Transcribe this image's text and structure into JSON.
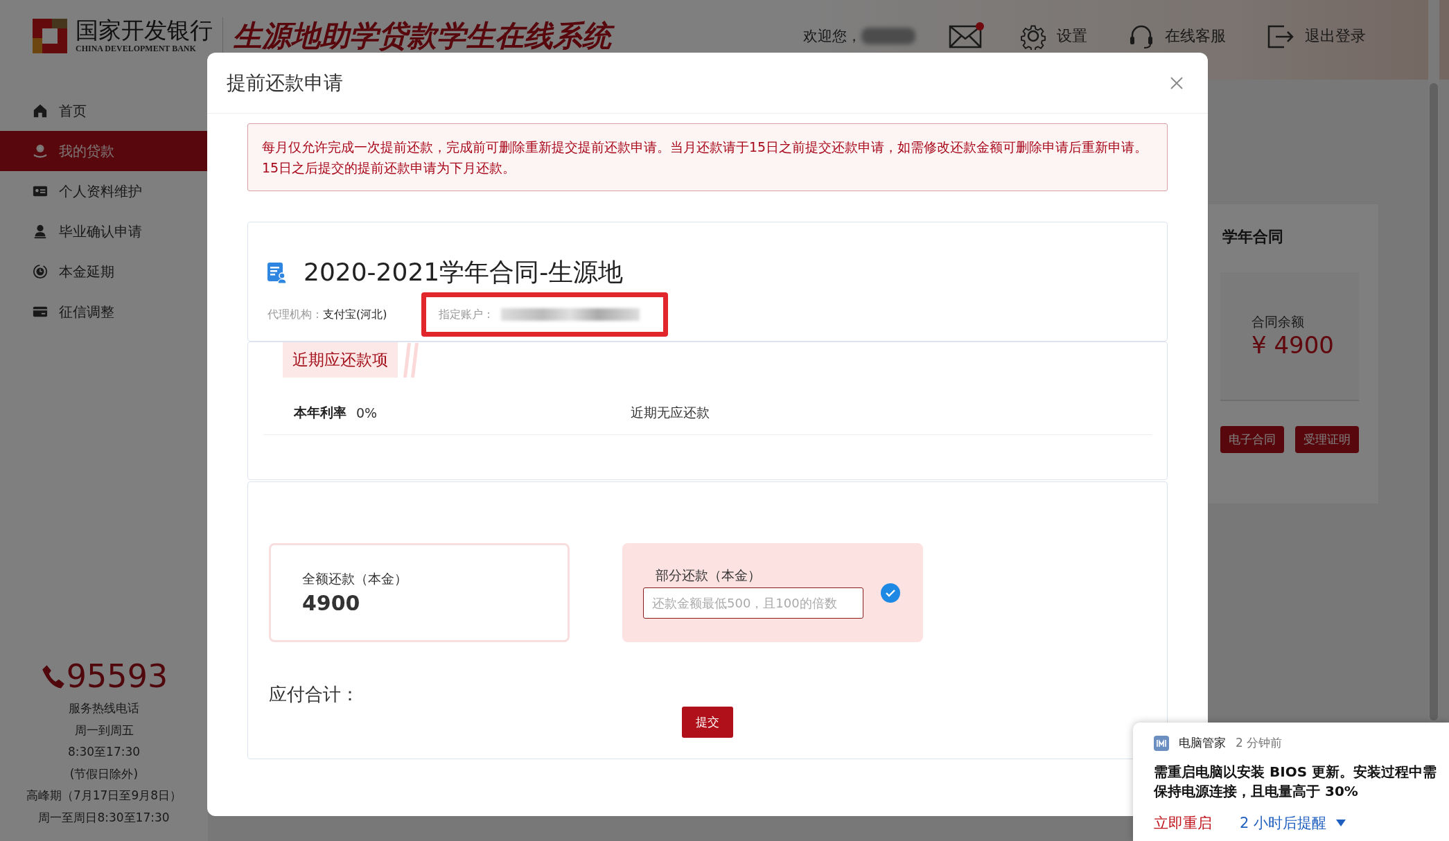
{
  "header": {
    "bank_name": "国家开发银行",
    "bank_name_en": "CHINA DEVELOPMENT BANK",
    "system_title": "生源地助学贷款学生在线系统",
    "welcome": "欢迎您，",
    "mail_unread": true,
    "actions": [
      {
        "label": "设置",
        "kind": "settings"
      },
      {
        "label": "在线客服",
        "kind": "support"
      },
      {
        "label": "退出登录",
        "kind": "logout"
      }
    ]
  },
  "sidebar": {
    "items": [
      {
        "label": "首页",
        "kind": "home",
        "selected": false
      },
      {
        "label": "我的贷款",
        "kind": "loan",
        "selected": true
      },
      {
        "label": "个人资料维护",
        "kind": "profile",
        "selected": false
      },
      {
        "label": "毕业确认申请",
        "kind": "graduate",
        "selected": false
      },
      {
        "label": "本金延期",
        "kind": "extend",
        "selected": false
      },
      {
        "label": "征信调整",
        "kind": "credit",
        "selected": false
      }
    ],
    "hotline": {
      "number": "95593",
      "lines": [
        "服务热线电话",
        "周一到周五",
        "8:30至17:30",
        "(节假日除外)",
        "高峰期（7月17日至9月8日）",
        "周一至周日8:30至17:30"
      ]
    }
  },
  "background_card": {
    "title": "学年合同",
    "balance_label": "合同余额",
    "balance": "¥ 4900",
    "buttons": [
      "电子合同",
      "受理证明"
    ]
  },
  "dialog": {
    "title": "提前还款申请",
    "notice": "每月仅允许完成一次提前还款，完成前可删除重新提交提前还款申请。当月还款请于15日之前提交还款申请，如需修改还款金额可删除申请后重新申请。15日之后提交的提前还款申请为下月还款。",
    "contract": {
      "title": "2020-2021学年合同-生源地",
      "agency_label": "代理机构：",
      "agency": "支付宝(河北)",
      "account_label": "指定账户：",
      "account_highlighted": true
    },
    "due": {
      "tag": "近期应还款项",
      "rate_label": "本年利率",
      "rate": "0%",
      "status": "近期无应还款"
    },
    "options": [
      {
        "kind": "amount",
        "label": "全额还款（本金）",
        "amount": "4900",
        "selected": false
      },
      {
        "kind": "input",
        "label": "部分还款（本金）",
        "placeholder": "还款金额最低500，且100的倍数",
        "selected": true
      }
    ],
    "total_label": "应付合计：",
    "submit": "提交"
  },
  "notification": {
    "app": "电脑管家",
    "time": "2 分钟前",
    "message": "需重启电脑以安装 BIOS 更新。安装过程中需保持电源连接，且电量高于 30%",
    "actions": [
      {
        "label": "立即重启",
        "kind": "primary"
      },
      {
        "label": "2 小时后提醒",
        "kind": "dropdown"
      }
    ]
  }
}
